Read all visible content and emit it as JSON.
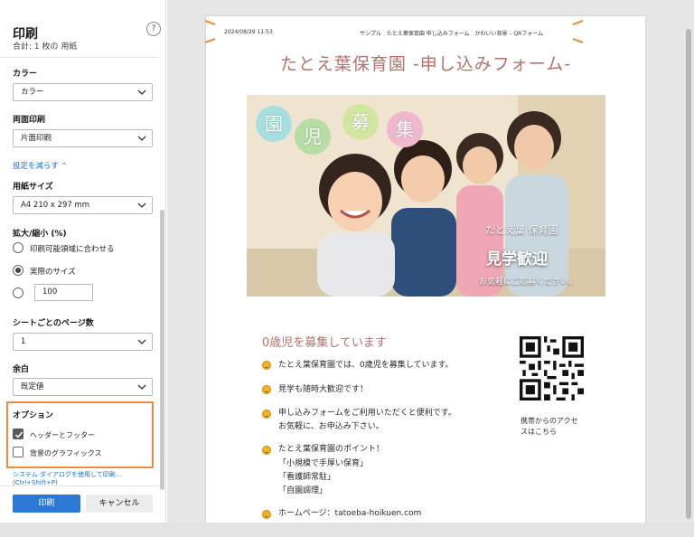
{
  "panel": {
    "title": "印刷",
    "subtitle": "合計: 1 枚の 用紙",
    "help": "?",
    "color_label": "カラー",
    "color_value": "カラー",
    "duplex_label": "両面印刷",
    "duplex_value": "片面印刷",
    "fewer_settings": "設定を減らす ⌃",
    "paper_label": "用紙サイズ",
    "paper_value": "A4 210 x 297 mm",
    "scale_label": "拡大/縮小 (%)",
    "scale_options": [
      "印刷可能領域に合わせる",
      "実際のサイズ"
    ],
    "scale_value": "100",
    "pages_per_sheet_label": "シートごとのページ数",
    "pages_per_sheet_value": "1",
    "margins_label": "余白",
    "margins_value": "既定値",
    "options_label": "オプション",
    "option_headers": "ヘッダーとフッター",
    "option_background": "背景のグラフィックス",
    "system_dialog": "システム ダイアログを使用して印刷... (Ctrl+Shift+P)",
    "print": "印刷",
    "cancel": "キャンセル"
  },
  "preview": {
    "header_date": "2024/08/29 11:53",
    "header_source": "サンプル　たとえ葉保育園 申し込みフォーム　かわいい背景 – QRフォーム",
    "title": "たとえ葉保育園 -申し込みフォーム-",
    "banner_bubbles": [
      "園",
      "児",
      "募",
      "集"
    ],
    "banner_name": "たとえ葉 保育園",
    "banner_headline": "見学歓迎",
    "banner_sub": "お気軽にご応募ください。",
    "subheading": "0歳児を募集しています",
    "items": [
      [
        "たとえ葉保育園では、0歳児を募集しています。"
      ],
      [
        "見学も随時大歓迎です！"
      ],
      [
        "申し込みフォームをご利用いただくと便利です。",
        "お気軽に、お申込み下さい。"
      ],
      [
        "たとえ葉保育園のポイント！",
        "「小規模で手厚い保育」",
        "「看護師常駐」",
        "「自園調理」"
      ],
      [
        "ホームページ：tatoeba-hoikuen.com"
      ]
    ],
    "qr_caption_1": "携帯からのアクセ",
    "qr_caption_2": "スはこちら"
  },
  "colors": {
    "accent": "#2a7ad5",
    "highlight": "#f08a3c",
    "title": "#b3736b"
  }
}
